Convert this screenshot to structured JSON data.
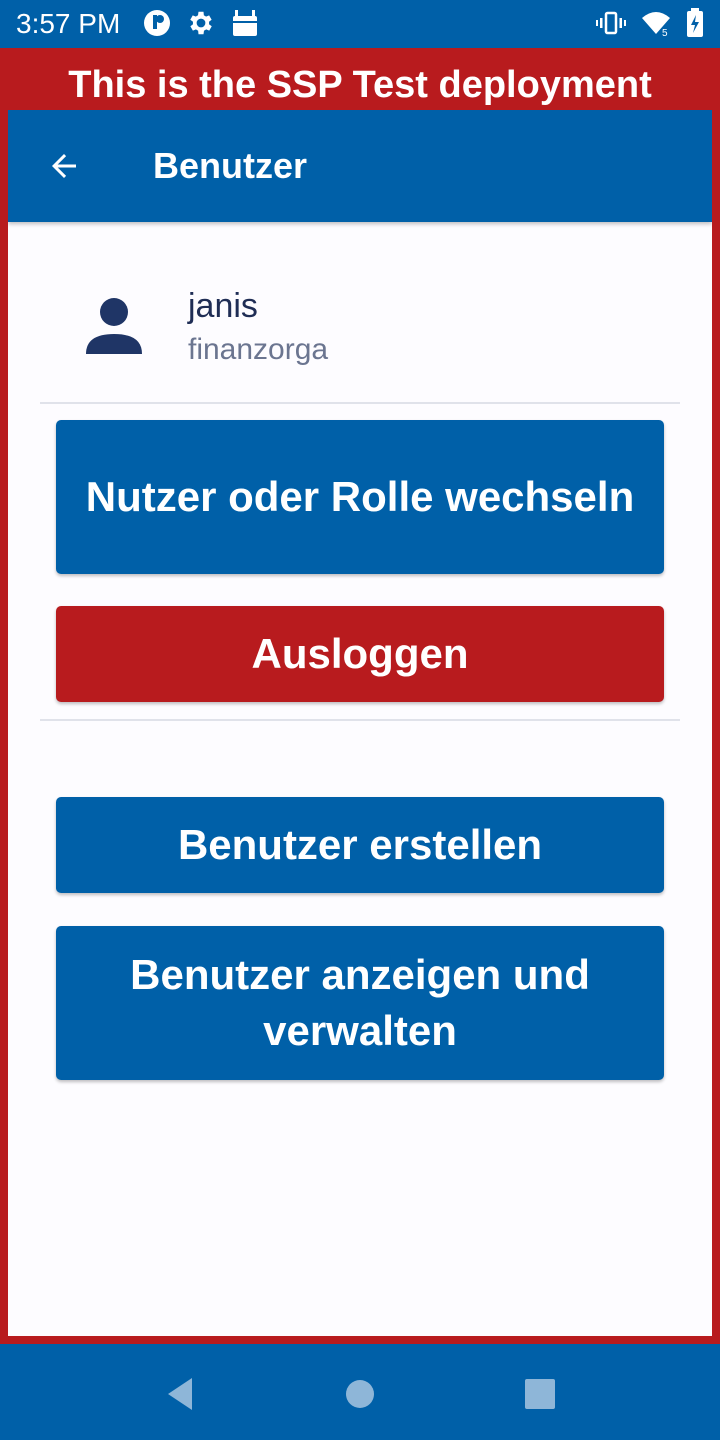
{
  "status_bar": {
    "time": "3:57 PM",
    "icons_left": [
      "app-notification-icon",
      "settings-icon",
      "android-icon"
    ],
    "icons_right": [
      "vibrate-icon",
      "wifi-icon",
      "battery-icon"
    ]
  },
  "banner": {
    "text": "This is the SSP Test deployment",
    "color": "#b81b1e"
  },
  "app_bar": {
    "title": "Benutzer",
    "back_icon": "arrow-back-icon",
    "color": "#0060a8"
  },
  "user": {
    "name": "janis",
    "organization": "finanzorga",
    "avatar_icon": "person-icon"
  },
  "buttons": {
    "switch_user": "Nutzer oder Rolle wechseln",
    "logout": "Ausloggen",
    "create_user": "Benutzer erstellen",
    "manage_users": "Benutzer anzeigen und verwalten"
  },
  "nav_bar": {
    "icons": [
      "back-nav-icon",
      "home-nav-icon",
      "recents-nav-icon"
    ]
  }
}
